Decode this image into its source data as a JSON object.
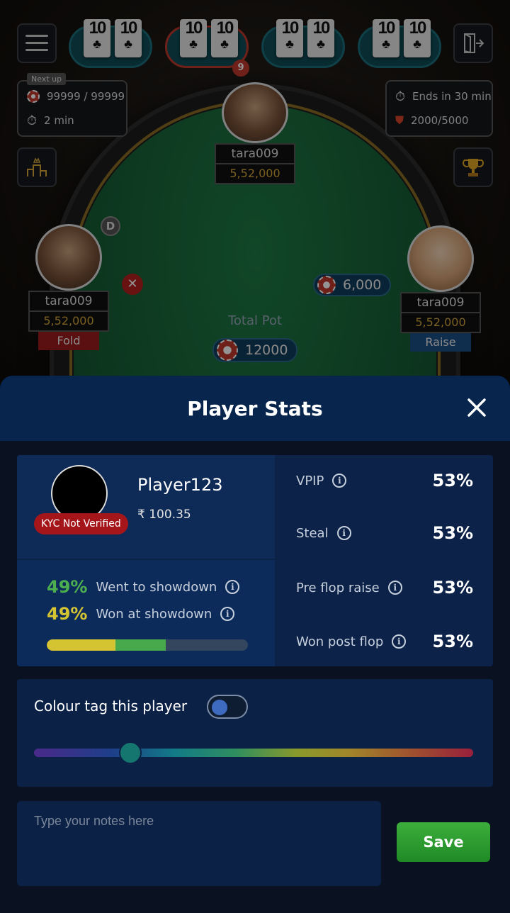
{
  "game": {
    "tables": [
      {
        "rank": "10",
        "suit": "♣"
      },
      {
        "rank": "10",
        "suit": "♣"
      },
      {
        "rank": "10",
        "suit": "♣"
      },
      {
        "rank": "10",
        "suit": "♣"
      }
    ],
    "active_table_badge": "9",
    "left_info": {
      "next_up": "Next up",
      "chips": "99999 / 99999",
      "time": "2 min"
    },
    "right_info": {
      "ends": "Ends in 30 min",
      "rank": "2000/5000"
    },
    "dealer_label": "D",
    "seats": {
      "top": {
        "name": "tara009",
        "chips": "5,52,000"
      },
      "left": {
        "name": "tara009",
        "chips": "5,52,000",
        "action": "Fold"
      },
      "right": {
        "name": "tara009",
        "chips": "5,52,000",
        "action": "Raise",
        "bet": "6,000"
      }
    },
    "pot": {
      "label": "Total Pot",
      "value": "12000"
    }
  },
  "sheet": {
    "title": "Player Stats",
    "player": {
      "name": "Player123",
      "balance": "₹ 100.35",
      "kyc": "KYC Not Verified"
    },
    "showdown": {
      "went": {
        "pct": "49%",
        "label": "Went to showdown",
        "color": "#4caf50"
      },
      "won": {
        "pct": "49%",
        "label": "Won at showdown",
        "color": "#d4c431"
      },
      "bar": {
        "won_fraction": 0.34,
        "went_fraction": 0.59
      }
    },
    "stats": [
      {
        "label": "VPIP",
        "value": "53%"
      },
      {
        "label": "Steal",
        "value": "53%"
      },
      {
        "label": "Pre flop raise",
        "value": "53%"
      },
      {
        "label": "Won post flop",
        "value": "53%"
      }
    ],
    "colour_tag": {
      "label": "Colour tag this player",
      "enabled": false,
      "slider_fraction": 0.22
    },
    "notes": {
      "placeholder": "Type your notes here",
      "value": ""
    },
    "save_label": "Save"
  }
}
